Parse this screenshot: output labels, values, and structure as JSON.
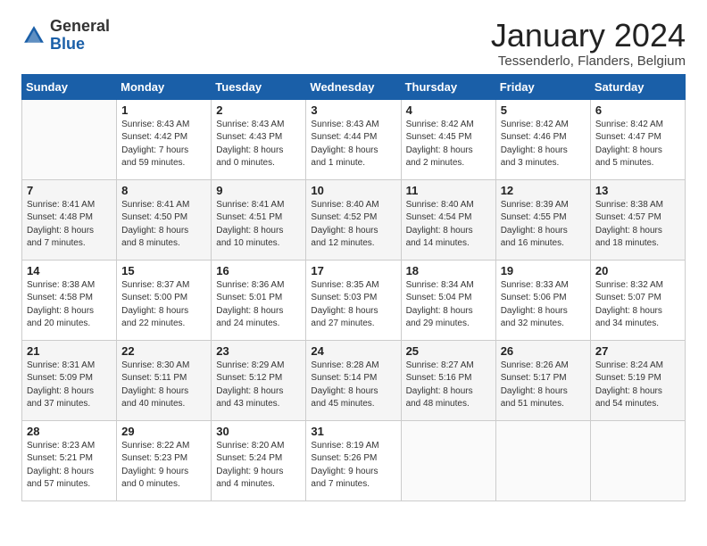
{
  "header": {
    "logo_general": "General",
    "logo_blue": "Blue",
    "title": "January 2024",
    "subtitle": "Tessenderlo, Flanders, Belgium"
  },
  "days_of_week": [
    "Sunday",
    "Monday",
    "Tuesday",
    "Wednesday",
    "Thursday",
    "Friday",
    "Saturday"
  ],
  "weeks": [
    [
      {
        "day": "",
        "info": ""
      },
      {
        "day": "1",
        "info": "Sunrise: 8:43 AM\nSunset: 4:42 PM\nDaylight: 7 hours\nand 59 minutes."
      },
      {
        "day": "2",
        "info": "Sunrise: 8:43 AM\nSunset: 4:43 PM\nDaylight: 8 hours\nand 0 minutes."
      },
      {
        "day": "3",
        "info": "Sunrise: 8:43 AM\nSunset: 4:44 PM\nDaylight: 8 hours\nand 1 minute."
      },
      {
        "day": "4",
        "info": "Sunrise: 8:42 AM\nSunset: 4:45 PM\nDaylight: 8 hours\nand 2 minutes."
      },
      {
        "day": "5",
        "info": "Sunrise: 8:42 AM\nSunset: 4:46 PM\nDaylight: 8 hours\nand 3 minutes."
      },
      {
        "day": "6",
        "info": "Sunrise: 8:42 AM\nSunset: 4:47 PM\nDaylight: 8 hours\nand 5 minutes."
      }
    ],
    [
      {
        "day": "7",
        "info": "Sunrise: 8:41 AM\nSunset: 4:48 PM\nDaylight: 8 hours\nand 7 minutes."
      },
      {
        "day": "8",
        "info": "Sunrise: 8:41 AM\nSunset: 4:50 PM\nDaylight: 8 hours\nand 8 minutes."
      },
      {
        "day": "9",
        "info": "Sunrise: 8:41 AM\nSunset: 4:51 PM\nDaylight: 8 hours\nand 10 minutes."
      },
      {
        "day": "10",
        "info": "Sunrise: 8:40 AM\nSunset: 4:52 PM\nDaylight: 8 hours\nand 12 minutes."
      },
      {
        "day": "11",
        "info": "Sunrise: 8:40 AM\nSunset: 4:54 PM\nDaylight: 8 hours\nand 14 minutes."
      },
      {
        "day": "12",
        "info": "Sunrise: 8:39 AM\nSunset: 4:55 PM\nDaylight: 8 hours\nand 16 minutes."
      },
      {
        "day": "13",
        "info": "Sunrise: 8:38 AM\nSunset: 4:57 PM\nDaylight: 8 hours\nand 18 minutes."
      }
    ],
    [
      {
        "day": "14",
        "info": "Sunrise: 8:38 AM\nSunset: 4:58 PM\nDaylight: 8 hours\nand 20 minutes."
      },
      {
        "day": "15",
        "info": "Sunrise: 8:37 AM\nSunset: 5:00 PM\nDaylight: 8 hours\nand 22 minutes."
      },
      {
        "day": "16",
        "info": "Sunrise: 8:36 AM\nSunset: 5:01 PM\nDaylight: 8 hours\nand 24 minutes."
      },
      {
        "day": "17",
        "info": "Sunrise: 8:35 AM\nSunset: 5:03 PM\nDaylight: 8 hours\nand 27 minutes."
      },
      {
        "day": "18",
        "info": "Sunrise: 8:34 AM\nSunset: 5:04 PM\nDaylight: 8 hours\nand 29 minutes."
      },
      {
        "day": "19",
        "info": "Sunrise: 8:33 AM\nSunset: 5:06 PM\nDaylight: 8 hours\nand 32 minutes."
      },
      {
        "day": "20",
        "info": "Sunrise: 8:32 AM\nSunset: 5:07 PM\nDaylight: 8 hours\nand 34 minutes."
      }
    ],
    [
      {
        "day": "21",
        "info": "Sunrise: 8:31 AM\nSunset: 5:09 PM\nDaylight: 8 hours\nand 37 minutes."
      },
      {
        "day": "22",
        "info": "Sunrise: 8:30 AM\nSunset: 5:11 PM\nDaylight: 8 hours\nand 40 minutes."
      },
      {
        "day": "23",
        "info": "Sunrise: 8:29 AM\nSunset: 5:12 PM\nDaylight: 8 hours\nand 43 minutes."
      },
      {
        "day": "24",
        "info": "Sunrise: 8:28 AM\nSunset: 5:14 PM\nDaylight: 8 hours\nand 45 minutes."
      },
      {
        "day": "25",
        "info": "Sunrise: 8:27 AM\nSunset: 5:16 PM\nDaylight: 8 hours\nand 48 minutes."
      },
      {
        "day": "26",
        "info": "Sunrise: 8:26 AM\nSunset: 5:17 PM\nDaylight: 8 hours\nand 51 minutes."
      },
      {
        "day": "27",
        "info": "Sunrise: 8:24 AM\nSunset: 5:19 PM\nDaylight: 8 hours\nand 54 minutes."
      }
    ],
    [
      {
        "day": "28",
        "info": "Sunrise: 8:23 AM\nSunset: 5:21 PM\nDaylight: 8 hours\nand 57 minutes."
      },
      {
        "day": "29",
        "info": "Sunrise: 8:22 AM\nSunset: 5:23 PM\nDaylight: 9 hours\nand 0 minutes."
      },
      {
        "day": "30",
        "info": "Sunrise: 8:20 AM\nSunset: 5:24 PM\nDaylight: 9 hours\nand 4 minutes."
      },
      {
        "day": "31",
        "info": "Sunrise: 8:19 AM\nSunset: 5:26 PM\nDaylight: 9 hours\nand 7 minutes."
      },
      {
        "day": "",
        "info": ""
      },
      {
        "day": "",
        "info": ""
      },
      {
        "day": "",
        "info": ""
      }
    ]
  ]
}
